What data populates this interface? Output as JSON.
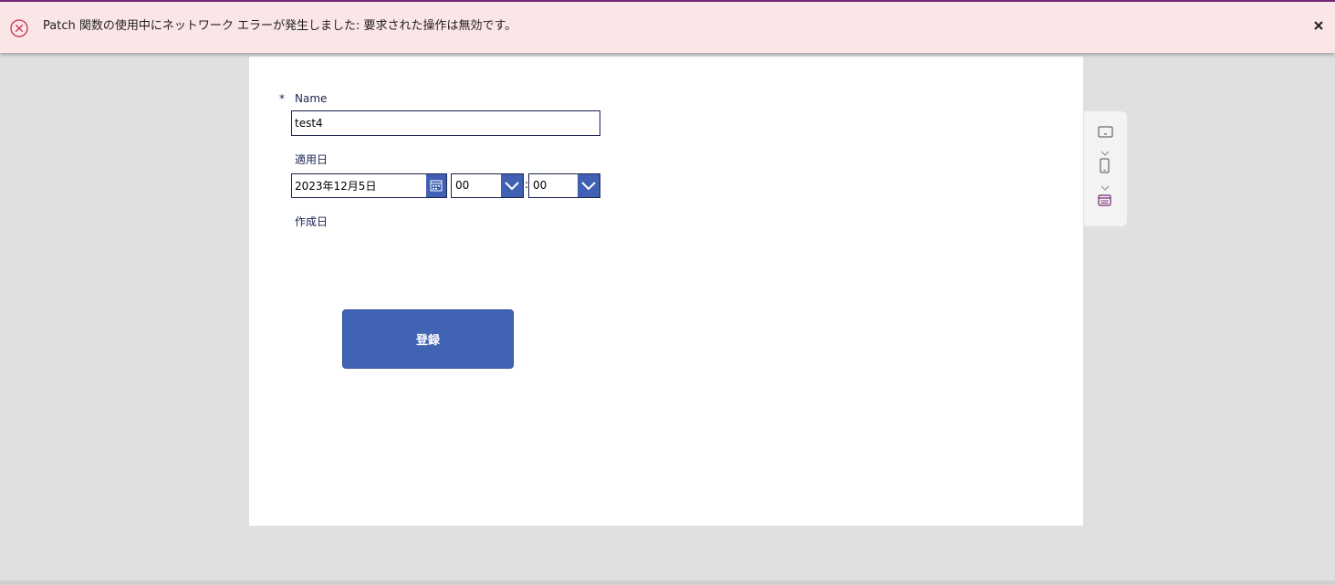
{
  "error": {
    "message": "Patch 関数の使用中にネットワーク エラーが発生しました: 要求された操作は無効です。",
    "icon": "error-circle-icon",
    "close_icon": "close-icon"
  },
  "form": {
    "name": {
      "required_mark": "*",
      "label": "Name",
      "value": "test4"
    },
    "apply_date": {
      "label": "適用日",
      "date_value": "2023年12月5日",
      "hour_value": "00",
      "separator": ":",
      "minute_value": "00"
    },
    "created_date": {
      "label": "作成日"
    },
    "submit_label": "登録"
  },
  "side_panel": {
    "icons": [
      "tablet-landscape-icon",
      "chevron-down-icon",
      "phone-icon",
      "chevron-down-icon",
      "form-icon"
    ]
  },
  "colors": {
    "accent": "#4063b3",
    "banner_bg": "#fbe6e7",
    "error_red": "#c4314b",
    "label_text": "#1a2350",
    "brand_purple": "#742774"
  }
}
